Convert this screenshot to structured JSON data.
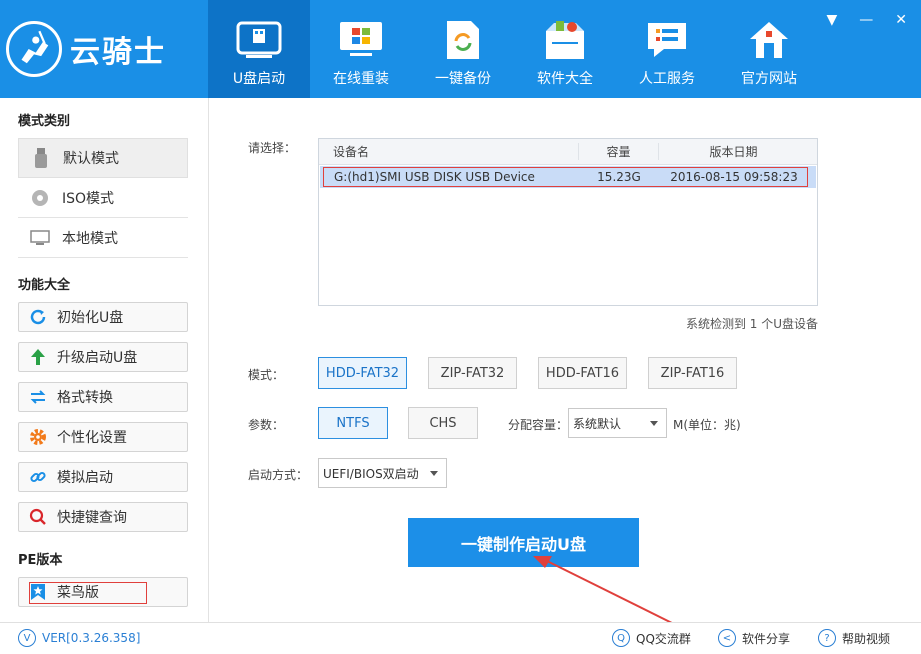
{
  "app": {
    "brand": "云骑士",
    "window_controls": {
      "menu": "▼",
      "minimize": "—",
      "close": "✕"
    }
  },
  "nav": [
    {
      "label": "U盘启动",
      "icon": "usb-drive-icon",
      "active": true
    },
    {
      "label": "在线重装",
      "icon": "windows-monitor-icon",
      "active": false
    },
    {
      "label": "一键备份",
      "icon": "backup-icon",
      "active": false
    },
    {
      "label": "软件大全",
      "icon": "software-box-icon",
      "active": false
    },
    {
      "label": "人工服务",
      "icon": "chat-service-icon",
      "active": false
    },
    {
      "label": "官方网站",
      "icon": "home-icon",
      "active": false
    }
  ],
  "sidebar": {
    "mode_title": "模式类别",
    "modes": [
      {
        "label": "默认模式",
        "icon": "usb-stick-icon",
        "selected": true
      },
      {
        "label": "ISO模式",
        "icon": "disc-icon",
        "selected": false
      },
      {
        "label": "本地模式",
        "icon": "monitor-icon",
        "selected": false
      }
    ],
    "func_title": "功能大全",
    "functions": [
      {
        "label": "初始化U盘",
        "icon": "refresh-icon"
      },
      {
        "label": "升级启动U盘",
        "icon": "arrow-up-icon"
      },
      {
        "label": "格式转换",
        "icon": "swap-arrows-icon"
      },
      {
        "label": "个性化设置",
        "icon": "gear-icon"
      },
      {
        "label": "模拟启动",
        "icon": "link-icon"
      },
      {
        "label": "快捷键查询",
        "icon": "search-icon"
      }
    ],
    "pe_title": "PE版本",
    "pe_items": [
      {
        "label": "菜鸟版",
        "icon": "bookmark-star-icon"
      }
    ]
  },
  "main": {
    "select_label": "请选择：",
    "table": {
      "headers": [
        "设备名",
        "容量",
        "版本日期"
      ],
      "rows": [
        {
          "name": "G:(hd1)SMI USB DISK USB Device",
          "capacity": "15.23G",
          "date": "2016-08-15 09:58:23"
        }
      ]
    },
    "detected": "系统检测到 1 个U盘设备",
    "mode_label": "模式：",
    "modes": [
      "HDD-FAT32",
      "ZIP-FAT32",
      "HDD-FAT16",
      "ZIP-FAT16"
    ],
    "param_label": "参数：",
    "params": [
      "NTFS",
      "CHS"
    ],
    "alloc_label": "分配容量：",
    "alloc_value": "系统默认",
    "alloc_unit": "M(单位：兆)",
    "boot_label": "启动方式：",
    "boot_value": "UEFI/BIOS双启动",
    "make_button": "一键制作启动U盘"
  },
  "footer": {
    "version": "VER[0.3.26.358]",
    "qq_group": "QQ交流群",
    "share": "软件分享",
    "help_video": "帮助视频"
  },
  "colors": {
    "header_bg": "#1a8fe6",
    "nav_active_bg": "#0d73c7",
    "primary_button": "#1c8fe8",
    "selection_outline": "#e0403c"
  }
}
